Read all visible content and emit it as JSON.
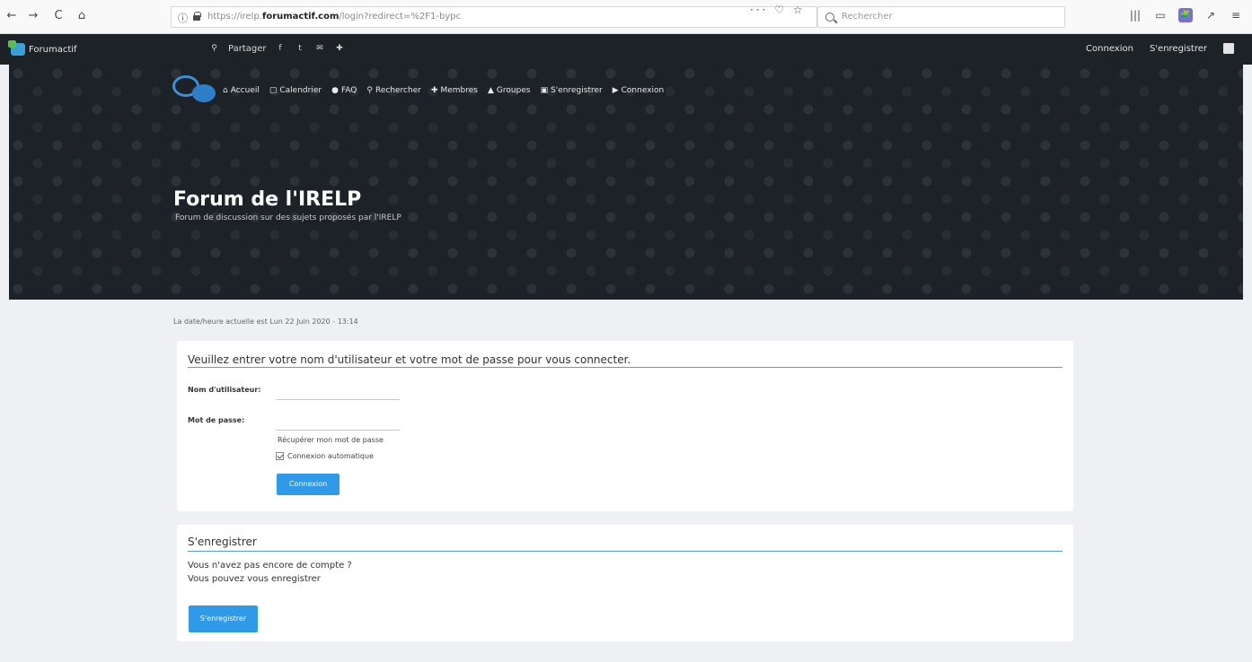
{
  "browser": {
    "back_icon": "←",
    "forward_icon": "→",
    "reload_icon": "C",
    "home_icon": "⌂",
    "info_icon": "ⓘ",
    "url_prefix": "https://irelp.",
    "url_domain": "forumactif.com",
    "url_suffix": "/login?redirect=%2F1-bypc",
    "url_actions": "··· ♡ ☆",
    "search_placeholder": "Rechercher",
    "toolbar_icons": [
      "|||",
      "▭",
      "🧩",
      "↗",
      "≡"
    ]
  },
  "topbar": {
    "brand": "Forumactif",
    "share_icon": "⚲",
    "share_label": "Partager",
    "social_icons": [
      "f",
      "t",
      "✉",
      "✚"
    ],
    "login": "Connexion",
    "register": "S'enregistrer"
  },
  "header": {
    "nav": [
      {
        "icon": "⌂",
        "label": "Accueil"
      },
      {
        "icon": "▢",
        "label": "Calendrier"
      },
      {
        "icon": "●",
        "label": "FAQ"
      },
      {
        "icon": "⚲",
        "label": "Rechercher"
      },
      {
        "icon": "✚",
        "label": "Membres"
      },
      {
        "icon": "▲",
        "label": "Groupes"
      },
      {
        "icon": "▣",
        "label": "S'enregistrer"
      },
      {
        "icon": "▶",
        "label": "Connexion"
      }
    ],
    "title": "Forum de l'IRELP",
    "description": "Forum de discussion sur des sujets proposés par l'IRELP"
  },
  "content": {
    "datetime": "La date/heure actuelle est Lun 22 Juin 2020 - 13:14",
    "login_panel": {
      "title": "Veuillez entrer votre nom d'utilisateur et votre mot de passe pour vous connecter.",
      "username_label": "Nom d'utilisateur:",
      "username_value": "",
      "password_label": "Mot de passe:",
      "password_value": "",
      "forgot_password": "Récupérer mon mot de passe",
      "autologin_label": "Connexion automatique",
      "autologin_checked": true,
      "submit": "Connexion"
    },
    "register_panel": {
      "title": "S'enregistrer",
      "line1": "Vous n'avez pas encore de compte ?",
      "line2": "Vous pouvez vous enregistrer",
      "button": "S'enregistrer"
    }
  },
  "colors": {
    "accent": "#2e9ae8",
    "header_bg": "#1c2227",
    "topbar_bg": "#1d2226",
    "page_bg": "#eef0f3",
    "rule": "#5b9bd5"
  }
}
